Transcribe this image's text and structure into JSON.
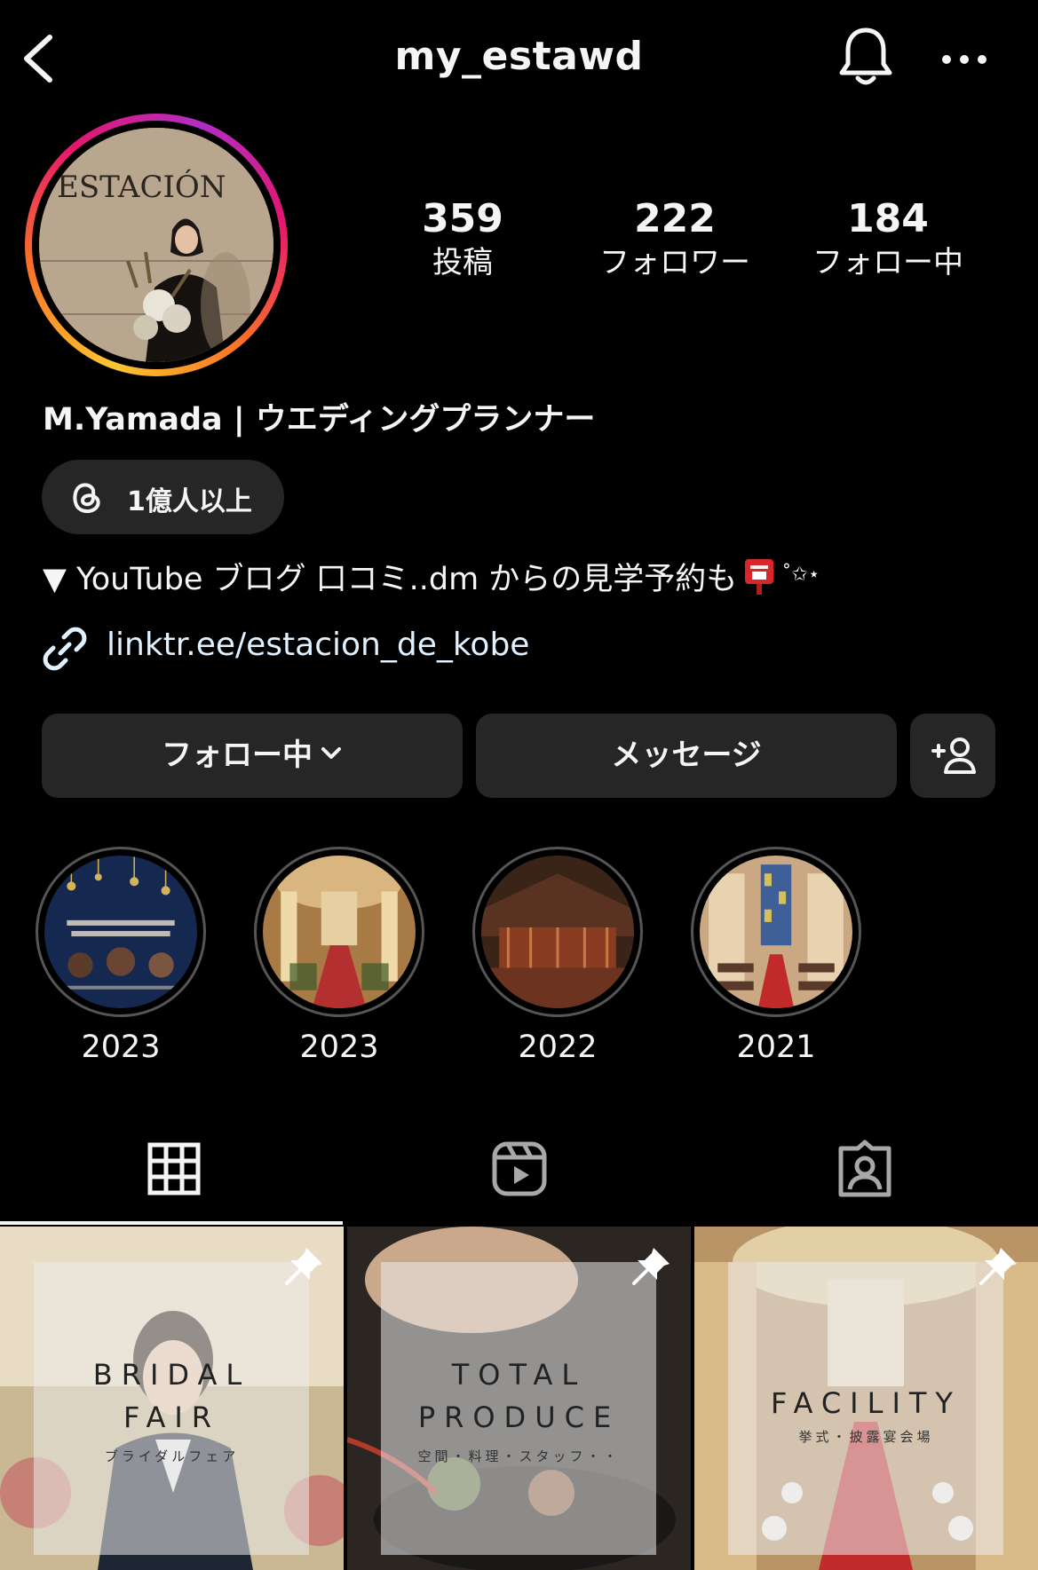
{
  "header": {
    "username": "my_estawd",
    "back_icon": "chevron-left-icon",
    "bell_icon": "bell-icon",
    "more_icon": "more-horizontal-icon"
  },
  "profile": {
    "avatar_text": "ESTACIÓN",
    "stats": [
      {
        "value": "359",
        "label": "投稿"
      },
      {
        "value": "222",
        "label": "フォロワー"
      },
      {
        "value": "184",
        "label": "フォロー中"
      }
    ],
    "display_name": "M.Yamada | ウエディングプランナー",
    "threads_badge": "1億人以上",
    "bio": "▼ YouTube ブログ 口コミ..dm からの見学予約も",
    "bio_sparkle": "˚✩⋆",
    "link": "linktr.ee/estacion_de_kobe"
  },
  "buttons": {
    "follow": "フォロー中",
    "message": "メッセージ",
    "add_user_icon": "add-user-icon"
  },
  "highlights": [
    {
      "label": "2023"
    },
    {
      "label": "2023"
    },
    {
      "label": "2022"
    },
    {
      "label": "2021"
    }
  ],
  "tabs": [
    "grid-icon",
    "reels-icon",
    "tagged-icon"
  ],
  "posts": [
    {
      "title_line1": "BRIDAL",
      "title_line2": "FAIR",
      "subtitle": "ブライダルフェア"
    },
    {
      "title_line1": "TOTAL",
      "title_line2": "PRODUCE",
      "subtitle": "空間・料理・スタッフ・・"
    },
    {
      "title_line1": "FACILITY",
      "title_line2": "",
      "subtitle": "挙式・披露宴会場"
    }
  ],
  "colors": {
    "background": "#000000",
    "button": "#262626",
    "link": "#e0f1ff"
  }
}
